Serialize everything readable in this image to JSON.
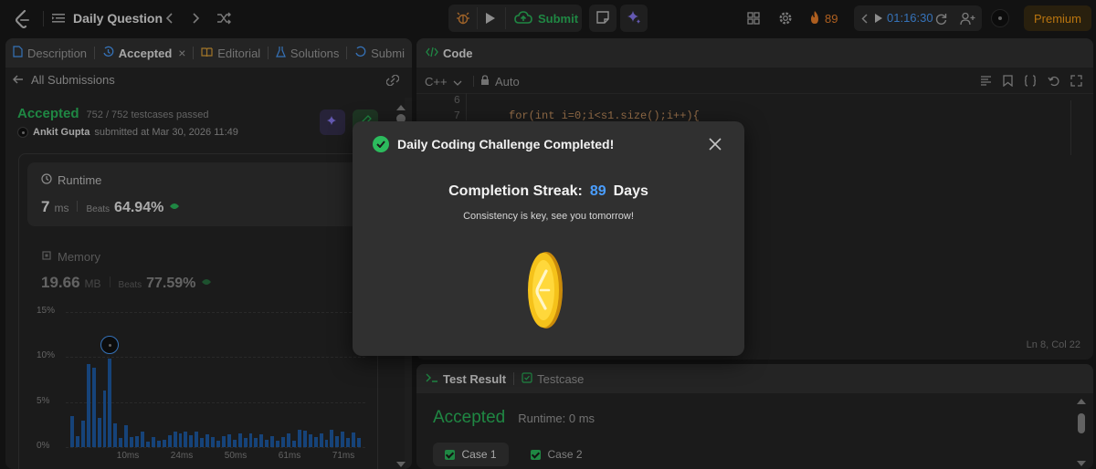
{
  "topbar": {
    "title": "Daily Question",
    "submit_label": "Submit",
    "streak_count": "89",
    "timer": "01:16:30",
    "premium_label": "Premium"
  },
  "left": {
    "tabs": [
      {
        "label": "Description"
      },
      {
        "label": "Accepted"
      },
      {
        "label": "Editorial"
      },
      {
        "label": "Solutions"
      },
      {
        "label": "Submi"
      }
    ],
    "back_label": "All Submissions",
    "status": "Accepted",
    "testcases": "752 / 752 testcases passed",
    "user": "Ankit Gupta",
    "submitted_text": "submitted at Mar 30, 2026 11:49",
    "runtime": {
      "label": "Runtime",
      "value": "7",
      "unit": "ms",
      "beats_label": "Beats",
      "beats": "64.94%"
    },
    "memory": {
      "label": "Memory",
      "value": "19.66",
      "unit": "MB",
      "beats_label": "Beats",
      "beats": "77.59%"
    }
  },
  "chart_data": {
    "type": "bar",
    "y_ticks": [
      "15%",
      "10%",
      "5%",
      "0%"
    ],
    "x_ticks": [
      "10ms",
      "24ms",
      "50ms",
      "61ms",
      "71ms"
    ],
    "ylim": [
      0,
      15
    ],
    "values": [
      3.4,
      1.2,
      2.9,
      9.2,
      8.8,
      3.2,
      6.3,
      9.8,
      2.6,
      1.0,
      2.4,
      1.1,
      1.2,
      1.7,
      0.6,
      1.1,
      0.7,
      0.8,
      1.3,
      1.7,
      1.5,
      1.7,
      1.3,
      1.7,
      1.0,
      1.4,
      1.1,
      0.7,
      1.2,
      1.4,
      0.8,
      1.5,
      1.0,
      1.5,
      1.0,
      1.4,
      0.8,
      1.2,
      0.7,
      1.1,
      1.5,
      0.7,
      1.9,
      1.8,
      1.4,
      1.1,
      1.5,
      0.8,
      1.9,
      1.2,
      1.7,
      1.0,
      1.6,
      1.0
    ],
    "highlight_index": 7
  },
  "code": {
    "header": "Code",
    "language": "C++",
    "mode": "Auto",
    "lines": [
      {
        "num": "6",
        "text": ""
      },
      {
        "num": "7",
        "text": "for(int i=0;i<s1.size();i++){"
      }
    ],
    "cursor_status": "Ln 8, Col 22"
  },
  "test": {
    "tab_result": "Test Result",
    "tab_case": "Testcase",
    "status": "Accepted",
    "runtime_text": "Runtime: 0 ms",
    "cases": [
      {
        "label": "Case 1"
      },
      {
        "label": "Case 2"
      }
    ]
  },
  "modal": {
    "title": "Daily Coding Challenge Completed!",
    "streak_label": "Completion Streak:",
    "streak_value": "89",
    "streak_unit": "Days",
    "message": "Consistency is key, see you tomorrow!"
  }
}
